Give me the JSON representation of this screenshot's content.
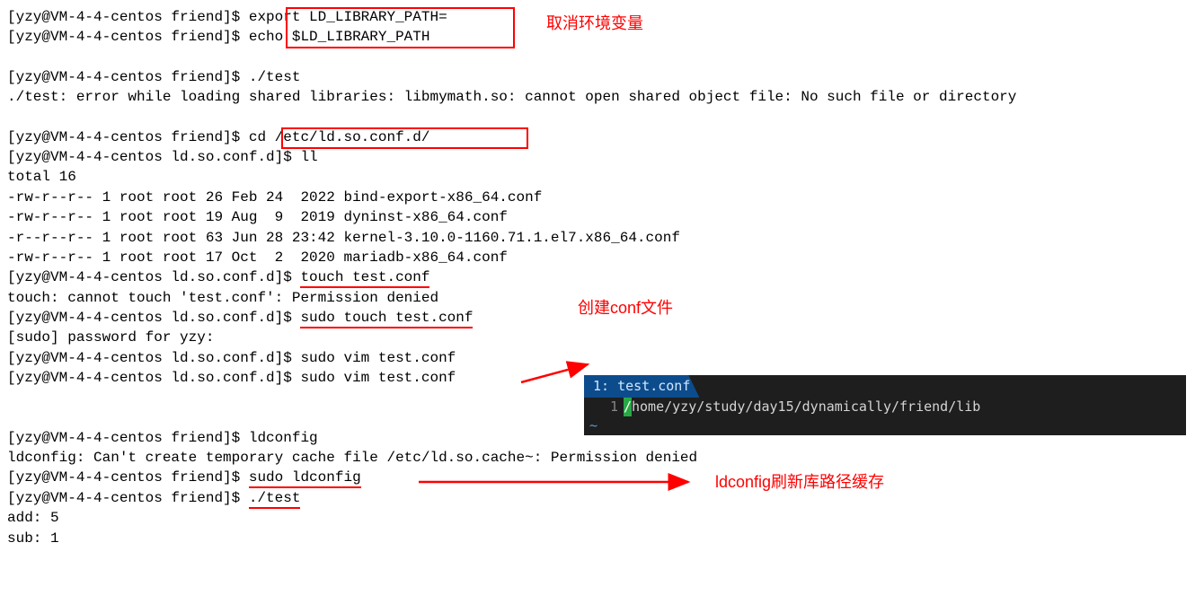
{
  "prompts": {
    "friend": "[yzy@VM-4-4-centos friend]$ ",
    "ldconf": "[yzy@VM-4-4-centos ld.so.conf.d]$ "
  },
  "block1": {
    "cmd_export": "export LD_LIBRARY_PATH=",
    "cmd_echo": "echo $LD_LIBRARY_PATH"
  },
  "anno1": "取消环境变量",
  "block2": {
    "cmd_test": "./test",
    "err": "./test: error while loading shared libraries: libmymath.so: cannot open shared object file: No such file or directory"
  },
  "block3": {
    "cmd_cd": "cd /etc/ld.so.conf.d/",
    "cmd_ll": "ll",
    "total": "total 16",
    "f1": "-rw-r--r-- 1 root root 26 Feb 24  2022 bind-export-x86_64.conf",
    "f2": "-rw-r--r-- 1 root root 19 Aug  9  2019 dyninst-x86_64.conf",
    "f3": "-r--r--r-- 1 root root 63 Jun 28 23:42 kernel-3.10.0-1160.71.1.el7.x86_64.conf",
    "f4": "-rw-r--r-- 1 root root 17 Oct  2  2020 mariadb-x86_64.conf",
    "cmd_touch": "touch test.conf",
    "touch_err": "touch: cannot touch 'test.conf': Permission denied",
    "cmd_sudo_touch": "sudo touch test.conf",
    "sudo_prompt": "[sudo] password for yzy: ",
    "cmd_vim1": "sudo vim test.conf",
    "cmd_vim2": "sudo vim test.conf"
  },
  "anno2": "创建conf文件",
  "editor": {
    "tab_num": "1: ",
    "tab_name": "test.conf",
    "line_num": "1",
    "cursor_char": "/",
    "path": "home/yzy/study/day15/dynamically/friend/lib",
    "tilde": "~"
  },
  "block4": {
    "cmd_ldconfig": "ldconfig",
    "ld_err": "ldconfig: Can't create temporary cache file /etc/ld.so.cache~: Permission denied",
    "cmd_sudo_ld": "sudo ldconfig",
    "cmd_test": "./test",
    "out1": "add: 5",
    "out2": "sub: 1"
  },
  "anno3": "ldconfig刷新库路径缓存"
}
